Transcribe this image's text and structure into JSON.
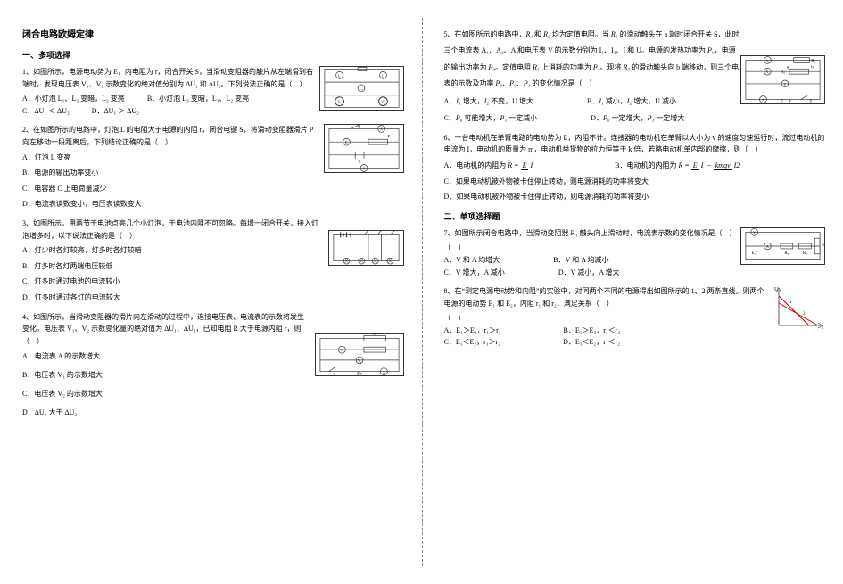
{
  "doc_title": "闭合电路欧姆定律",
  "section1": "一、多项选择",
  "section2": "二、单项选择题",
  "q1": {
    "stem": "1、如图所示，电源电动势为 E，内电阻为 r，闭合开关 S，当滑动变阻器的触片从左端滑到右端时，发现电压表 V₁、V₂ 示数变化的绝对值分别为 ΔU₁ 和 ΔU₂。下列说法正确的是（　）",
    "A": "A．小灯泡 L₁、L₃ 变暗，L₂ 变亮",
    "B": "B．小灯泡 L₃ 变暗，L₁、L₂ 变亮",
    "C": "C．ΔU₁ ＜ ΔU₂",
    "D": "D．ΔU₁ ＞ ΔU₂"
  },
  "q2": {
    "stem": "2、在如图所示的电路中，灯泡 L 的电阻大于电源的内阻 r，闭合电键 S，将滑动变阻器滑片 P 向左移动一段距离后，下列结论正确的是（　）",
    "A": "A．灯泡 L 变亮",
    "B": "B．电源的输出功率变小",
    "C": "C．电容器 C 上电荷量减少",
    "D": "D．电流表读数变小，电压表读数变大"
  },
  "q3": {
    "stem": "3、如图所示，用两节干电池点亮几个小灯泡，干电池内阻不可忽略。每增一闭合开关，接入灯泡增多时，以下说法正确的是（　）",
    "A": "A．灯少时各灯较亮，灯多时各灯较暗",
    "B": "B．灯多时各灯两端电压较低",
    "C": "C．灯多时通过电池的电流较小",
    "D": "D．灯多时通过各灯的电流较大"
  },
  "q4": {
    "stem": "4、如图所示，当滑动变阻器的滑片向左滑动的过程中，连接电压表、电流表的示数将发生变化。电压表 V₁、V₂ 示数变化量的绝对值为 ΔU₁、ΔU₂，已知电阻 R 大于电源内阻 r，则（　）",
    "A": "A．电流表 A 的示数增大",
    "B": "B．电压表 V₁ 的示数增大",
    "C": "C．电压表 V₂ 的示数增大",
    "D": "D．ΔU₁ 大于 ΔU₂"
  },
  "q5": {
    "stem_pre": "5、在如图所示的电路中，",
    "stem_mid": " 和 ",
    "stem_r1": "R₁",
    "stem_r2": "R₂",
    "stem_post": " 均为定值电阻。当 ",
    "stem_r3": "R₃",
    "stem_post2": " 的滑动触头在 a 端时闭合开关 S，此时三个电流表 A₁、A₂、A 和电压表 V 的示数分别为 I₁、I₂、I 和 U。电源的发热功率为 ",
    "stem_p0": "P₀",
    "stem_post3": "，电源的输出功率为 ",
    "stem_pe": "P₀",
    "stem_post4": "。定值电阻 ",
    "stem_r1b": "R₁",
    "stem_post5": " 上消耗的功率为 ",
    "stem_p1": "P₁",
    "stem_post6": "。现将 ",
    "stem_r3b": "R₃",
    "stem_post7": " 的滑动触头向 b 端移动，则三个电表的示数及功率 ",
    "stem_pe2": "P₀",
    "stem_c": "、",
    "stem_p0b": "P₀",
    "stem_c2": "、",
    "stem_p1b": "P₁",
    "stem_post8": " 的变化情况是（　）",
    "A_pre": "A．",
    "A_i1": "I₁",
    "A_mid1": " 增大，",
    "A_i2": "I₂",
    "A_mid2": " 不变，U 增大",
    "B_pre": "B．",
    "B_i1": "I₁",
    "B_mid1": " 减小，",
    "B_i2": "I₂",
    "B_mid2": " 增大，U 减小",
    "C_pre": "C．",
    "C_p0": "P₀",
    "C_mid": " 可能增大，",
    "C_p1": "P₁",
    "C_end": " 一定减小",
    "D_pre": "D．",
    "D_p0": "P₀",
    "D_mid": " 一定增大，",
    "D_p1": "P₁",
    "D_end": " 一定增大"
  },
  "q6": {
    "stem": "6、一台电动机在单臂电路的电动势为 E，内阻不计。连接器的电动机在单臂以大小为 v 的速度匀速运行时，流过电动机的电流为 I，电动机的质量为 m，电动机举货物的拉力恒等于 k 倍，若略电动机单内部的摩擦，则（　）",
    "A_pre": "A．电动机的内阻为 ",
    "A_eq": "R = ",
    "B_pre": "B．电动机的内阻为 ",
    "B_eq": "R = ",
    "C": "C．如果电动机被外物被卡住停止转动，则电源消耗的功率将变大",
    "D": "D．如果电动机被外物被卡住停止转动，则电源消耗的功率将变小"
  },
  "q7": {
    "stem": "7、如图所示闭合电路中，当滑动变阻器 R₁ 触头向上滑动时，电流表示数的变化情况是（　）",
    "A": "A．V 和 A 均增大",
    "B": "B．V 和 A 均减小",
    "C": "C．V 增大，A 减小",
    "D": "D．V 减小，A 增大"
  },
  "q8": {
    "stem": "8、在“测定电源电动势和内阻”的实验中，对同两个不同的电源得出如图所示的 1、2 两条直线。则两个电源的电动势 E₁ 和 E₂，内阻 r₁ 和 r₂，满足关系（　）",
    "A": "A．E₁＞E₂，r₁＞r₂",
    "B": "B．E₁＞E₂，r₁＜r₂",
    "C": "C．E₁＜E₂，r₁＞r₂",
    "D": "D．E₁＜E₂，r₁＜r₂"
  },
  "fraction_E": "E",
  "fraction_I": "I",
  "fraction_kmgv": "kmgv",
  "fraction_I2": "I2",
  "minus": " − "
}
